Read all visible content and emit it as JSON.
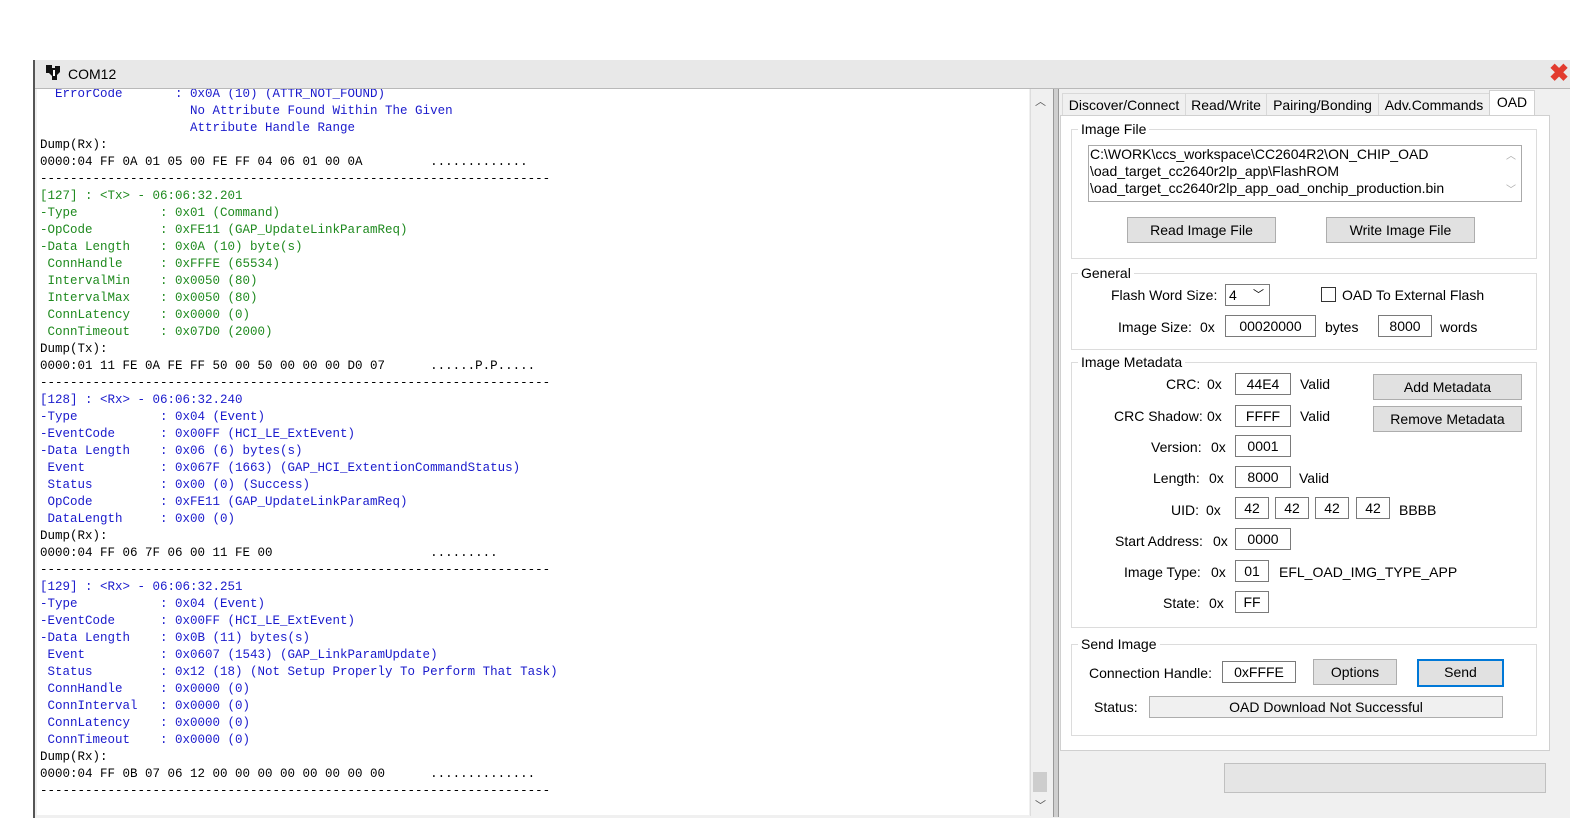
{
  "window": {
    "title": "COM12"
  },
  "log_lines": [
    {
      "t": "  ErrorCode       : 0x0A (10) (ATTR_NOT_FOUND)",
      "c": "blue"
    },
    {
      "t": "                    No Attribute Found Within The Given",
      "c": "blue"
    },
    {
      "t": "                    Attribute Handle Range",
      "c": "blue"
    },
    {
      "t": "Dump(Rx):",
      "c": "black"
    },
    {
      "t": "0000:04 FF 0A 01 05 00 FE FF 04 06 01 00 0A         .............",
      "c": "black"
    },
    {
      "t": "--------------------------------------------------------------------",
      "c": "black"
    },
    {
      "t": "[127] : <Tx> - 06:06:32.201",
      "c": "green"
    },
    {
      "t": "-Type           : 0x01 (Command)",
      "c": "green"
    },
    {
      "t": "-OpCode         : 0xFE11 (GAP_UpdateLinkParamReq)",
      "c": "green"
    },
    {
      "t": "-Data Length    : 0x0A (10) byte(s)",
      "c": "green"
    },
    {
      "t": " ConnHandle     : 0xFFFE (65534)",
      "c": "green"
    },
    {
      "t": " IntervalMin    : 0x0050 (80)",
      "c": "green"
    },
    {
      "t": " IntervalMax    : 0x0050 (80)",
      "c": "green"
    },
    {
      "t": " ConnLatency    : 0x0000 (0)",
      "c": "green"
    },
    {
      "t": " ConnTimeout    : 0x07D0 (2000)",
      "c": "green"
    },
    {
      "t": "Dump(Tx):",
      "c": "black"
    },
    {
      "t": "0000:01 11 FE 0A FE FF 50 00 50 00 00 00 D0 07      ......P.P.....",
      "c": "black"
    },
    {
      "t": "--------------------------------------------------------------------",
      "c": "black"
    },
    {
      "t": "[128] : <Rx> - 06:06:32.240",
      "c": "blue"
    },
    {
      "t": "-Type           : 0x04 (Event)",
      "c": "blue"
    },
    {
      "t": "-EventCode      : 0x00FF (HCI_LE_ExtEvent)",
      "c": "blue"
    },
    {
      "t": "-Data Length    : 0x06 (6) bytes(s)",
      "c": "blue"
    },
    {
      "t": " Event          : 0x067F (1663) (GAP_HCI_ExtentionCommandStatus)",
      "c": "blue"
    },
    {
      "t": " Status         : 0x00 (0) (Success)",
      "c": "blue"
    },
    {
      "t": " OpCode         : 0xFE11 (GAP_UpdateLinkParamReq)",
      "c": "blue"
    },
    {
      "t": " DataLength     : 0x00 (0)",
      "c": "blue"
    },
    {
      "t": "Dump(Rx):",
      "c": "black"
    },
    {
      "t": "0000:04 FF 06 7F 06 00 11 FE 00                     .........",
      "c": "black"
    },
    {
      "t": "--------------------------------------------------------------------",
      "c": "black"
    },
    {
      "t": "[129] : <Rx> - 06:06:32.251",
      "c": "blue"
    },
    {
      "t": "-Type           : 0x04 (Event)",
      "c": "blue"
    },
    {
      "t": "-EventCode      : 0x00FF (HCI_LE_ExtEvent)",
      "c": "blue"
    },
    {
      "t": "-Data Length    : 0x0B (11) bytes(s)",
      "c": "blue"
    },
    {
      "t": " Event          : 0x0607 (1543) (GAP_LinkParamUpdate)",
      "c": "blue"
    },
    {
      "t": " Status         : 0x12 (18) (Not Setup Properly To Perform That Task)",
      "c": "blue"
    },
    {
      "t": " ConnHandle     : 0x0000 (0)",
      "c": "blue"
    },
    {
      "t": " ConnInterval   : 0x0000 (0)",
      "c": "blue"
    },
    {
      "t": " ConnLatency    : 0x0000 (0)",
      "c": "blue"
    },
    {
      "t": " ConnTimeout    : 0x0000 (0)",
      "c": "blue"
    },
    {
      "t": "Dump(Rx):",
      "c": "black"
    },
    {
      "t": "0000:04 FF 0B 07 06 12 00 00 00 00 00 00 00 00      ..............",
      "c": "black"
    },
    {
      "t": "--------------------------------------------------------------------",
      "c": "black"
    }
  ],
  "colors": {
    "blue": "#1a1acc",
    "green": "#1f8a1f",
    "black": "#000000"
  },
  "tabs": [
    "Discover/Connect",
    "Read/Write",
    "Pairing/Bonding",
    "Adv.Commands",
    "OAD"
  ],
  "image_file": {
    "group_label": "Image File",
    "path_lines": [
      "C:\\WORK\\ccs_workspace\\CC2604R2\\ON_CHIP_OAD",
      "\\oad_target_cc2640r2lp_app\\FlashROM",
      "\\oad_target_cc2640r2lp_app_oad_onchip_production.bin"
    ],
    "read_button": "Read Image File",
    "write_button": "Write Image File"
  },
  "general": {
    "group_label": "General",
    "flash_word_size_label": "Flash Word Size:",
    "flash_word_size_value": "4",
    "oad_external_label": "OAD To External Flash",
    "image_size_label": "Image Size:",
    "hex_prefix": "0x",
    "image_size_value": "00020000",
    "bytes_label": "bytes",
    "words_value": "8000",
    "words_label": "words"
  },
  "metadata": {
    "group_label": "Image Metadata",
    "crc_label": "CRC:",
    "crc_value": "44E4",
    "crc_status": "Valid",
    "crc_shadow_label": "CRC Shadow:",
    "crc_shadow_value": "FFFF",
    "crc_shadow_status": "Valid",
    "version_label": "Version:",
    "version_value": "0001",
    "length_label": "Length:",
    "length_value": "8000",
    "length_status": "Valid",
    "uid_label": "UID:",
    "uid_values": [
      "42",
      "42",
      "42",
      "42"
    ],
    "uid_text": "BBBB",
    "start_label": "Start Address:",
    "start_value": "0000",
    "type_label": "Image Type:",
    "type_value": "01",
    "type_text": "EFL_OAD_IMG_TYPE_APP",
    "state_label": "State:",
    "state_value": "FF",
    "add_button": "Add Metadata",
    "remove_button": "Remove Metadata"
  },
  "send_image": {
    "group_label": "Send Image",
    "conn_handle_label": "Connection Handle:",
    "conn_handle_value": "0xFFFE",
    "options_button": "Options",
    "send_button": "Send",
    "status_label": "Status:",
    "status_value": "OAD Download Not Successful"
  }
}
